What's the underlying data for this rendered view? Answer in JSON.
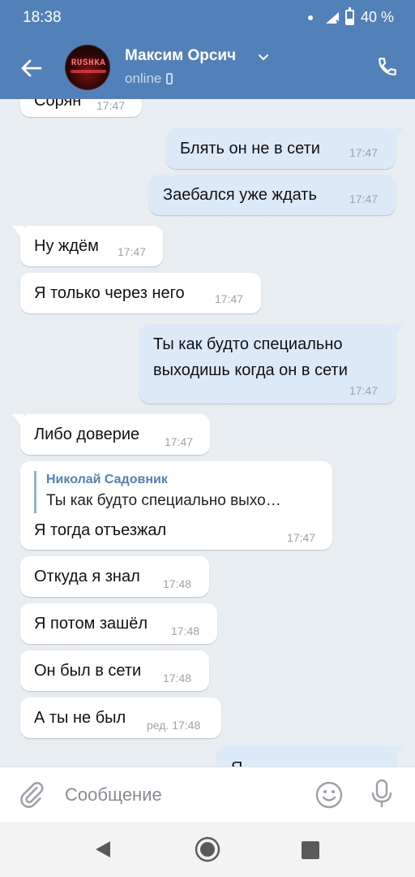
{
  "status_bar": {
    "time": "18:38",
    "battery": "40 %",
    "battery_level": 0.4
  },
  "header": {
    "name": "Максим Орсич",
    "status": "online",
    "avatar_text": "RUSHKA"
  },
  "messages": [
    {
      "dir": "in",
      "text": "Сорян",
      "time": "17:47"
    },
    {
      "dir": "out",
      "text": "Блять он не в сети",
      "time": "17:47"
    },
    {
      "dir": "out",
      "text": "Заебался уже ждать",
      "time": "17:47"
    },
    {
      "dir": "in",
      "text": "Ну ждём",
      "time": "17:47"
    },
    {
      "dir": "in",
      "text": "Я только через него",
      "time": "17:47"
    },
    {
      "dir": "out",
      "lines": [
        "Ты как будто специально",
        "выходишь когда он в сети"
      ],
      "time": "17:47"
    },
    {
      "dir": "in",
      "text": "Либо доверие",
      "time": "17:47"
    },
    {
      "dir": "in",
      "reply_author": "Николай Садовник",
      "reply_text": "Ты как будто специально выхо…",
      "text": "Я тогда отъезжал",
      "time": "17:47"
    },
    {
      "dir": "in",
      "text": "Откуда я знал",
      "time": "17:48"
    },
    {
      "dir": "in",
      "text": "Я потом зашёл",
      "time": "17:48"
    },
    {
      "dir": "in",
      "text": "Он был в сети",
      "time": "17:48"
    },
    {
      "dir": "in",
      "text": "А ты не был",
      "time": "ред. 17:48"
    },
    {
      "dir": "out",
      "text": "Я",
      "time": ""
    }
  ],
  "input": {
    "placeholder": "Сообщение"
  },
  "colors": {
    "header": "#5181b8",
    "incoming": "#ffffff",
    "outgoing": "#dce9f8",
    "background": "#e8edf2"
  },
  "icons": [
    "back-arrow-icon",
    "chevron-down-icon",
    "phone-icon",
    "paperclip-icon",
    "emoji-icon",
    "microphone-icon",
    "nav-back-icon",
    "nav-home-icon",
    "nav-recents-icon"
  ]
}
